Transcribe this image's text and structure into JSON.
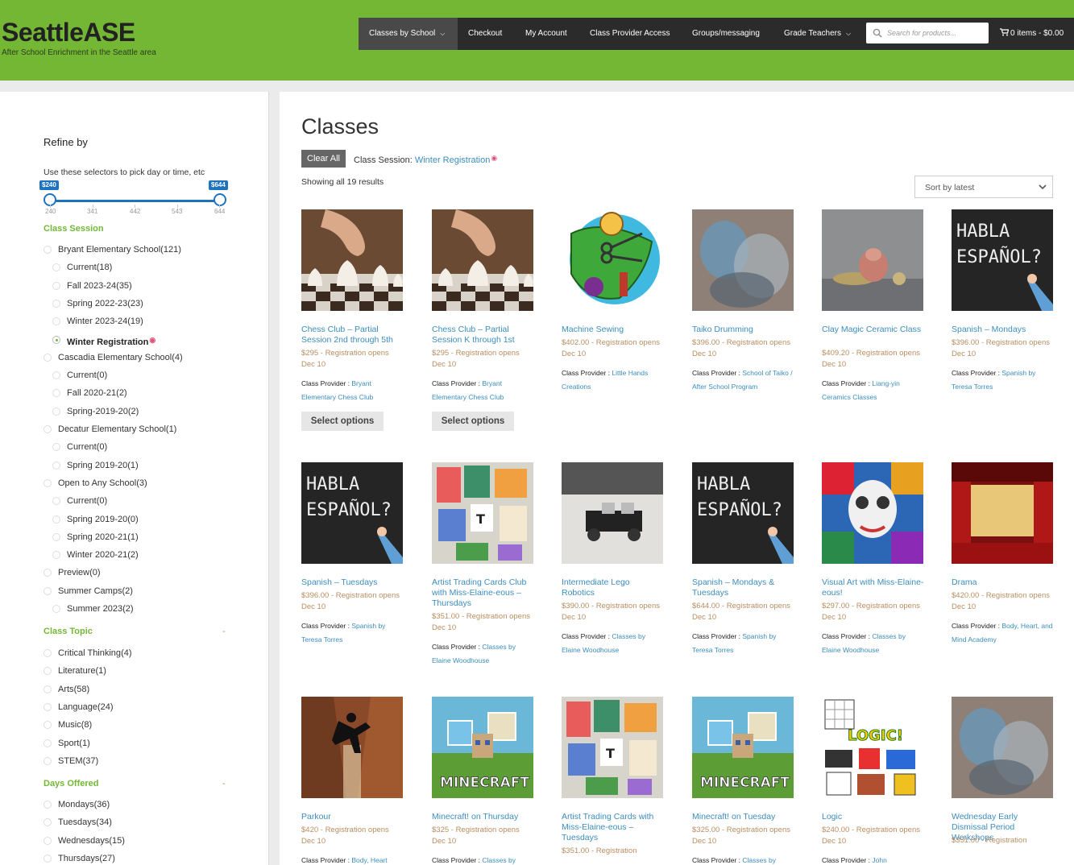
{
  "site": {
    "title": "SeattleASE",
    "tagline": "After School Enrichment in the Seattle area"
  },
  "nav": {
    "items": [
      {
        "label": "Classes by School",
        "has_caret": true
      },
      {
        "label": "Checkout"
      },
      {
        "label": "My Account"
      },
      {
        "label": "Class Provider Access"
      },
      {
        "label": "Groups/messaging"
      },
      {
        "label": "Grade Teachers",
        "has_caret": true
      }
    ],
    "search_placeholder": "Search for products...",
    "cart": "0 items - $0.00"
  },
  "sidebar": {
    "refine_title": "Refine by",
    "selectors_hint": "Use these selectors to pick day or time, etc",
    "price": {
      "min_label": "$240",
      "max_label": "$644",
      "ticks": [
        "240",
        "341",
        "442",
        "543",
        "644"
      ]
    },
    "class_session": {
      "title": "Class Session",
      "items": [
        {
          "label": "Bryant Elementary School",
          "count": "(121)",
          "level": 0
        },
        {
          "label": "Current",
          "count": "(18)",
          "level": 1
        },
        {
          "label": "Fall 2023-24",
          "count": "(35)",
          "level": 1
        },
        {
          "label": "Spring 2022-23",
          "count": "(23)",
          "level": 1
        },
        {
          "label": "Winter 2023-24",
          "count": "(19)",
          "level": 1
        },
        {
          "label": "Winter Registration",
          "count": "",
          "level": 1,
          "selected": true
        },
        {
          "label": "Cascadia Elementary School",
          "count": "(4)",
          "level": 0
        },
        {
          "label": "Current",
          "count": "(0)",
          "level": 1
        },
        {
          "label": "Fall 2020-21",
          "count": "(2)",
          "level": 1
        },
        {
          "label": "Spring-2019-20",
          "count": "(2)",
          "level": 1
        },
        {
          "label": "Decatur Elementary School",
          "count": "(1)",
          "level": 0
        },
        {
          "label": "Current",
          "count": "(0)",
          "level": 1
        },
        {
          "label": "Spring 2019-20",
          "count": "(1)",
          "level": 1
        },
        {
          "label": "Open to Any School",
          "count": "(3)",
          "level": 0
        },
        {
          "label": "Current",
          "count": "(0)",
          "level": 1
        },
        {
          "label": "Spring 2019-20",
          "count": "(0)",
          "level": 1
        },
        {
          "label": "Spring 2020-21",
          "count": "(1)",
          "level": 1
        },
        {
          "label": "Winter 2020-21",
          "count": "(2)",
          "level": 1
        },
        {
          "label": "Preview",
          "count": "(0)",
          "level": 0
        },
        {
          "label": "Summer Camps",
          "count": "(2)",
          "level": 0
        },
        {
          "label": "Summer 2023",
          "count": "(2)",
          "level": 1
        }
      ]
    },
    "class_topic": {
      "title": "Class Topic",
      "toggle": "-",
      "items": [
        {
          "label": "Critical Thinking",
          "count": "(4)"
        },
        {
          "label": "Literature",
          "count": "(1)"
        },
        {
          "label": "Arts",
          "count": "(58)"
        },
        {
          "label": "Language",
          "count": "(24)"
        },
        {
          "label": "Music",
          "count": "(8)"
        },
        {
          "label": "Sport",
          "count": "(1)"
        },
        {
          "label": "STEM",
          "count": "(37)"
        }
      ]
    },
    "days_offered": {
      "title": "Days Offered",
      "toggle": "-",
      "items": [
        {
          "label": "Mondays",
          "count": "(36)"
        },
        {
          "label": "Tuesdays",
          "count": "(34)"
        },
        {
          "label": "Wednesdays",
          "count": "(15)"
        },
        {
          "label": "Thursdays",
          "count": "(27)"
        }
      ]
    }
  },
  "main": {
    "title": "Classes",
    "clear_all": "Clear All",
    "active_filter": {
      "label": "Class Session:",
      "value": "Winter Registration"
    },
    "results": "Showing all 19 results",
    "sort": "Sort by latest",
    "provider_prefix": "Class Provider :",
    "products": [
      {
        "name": "Chess Club – Partial Session 2nd through 5th",
        "price": "$295 - Registration opens Dec 10",
        "provider": "Bryant Elementary Chess Club",
        "button": "Select options",
        "image": "chess"
      },
      {
        "name": "Chess Club – Partial Session K through 1st",
        "price": "$295 - Registration opens Dec 10",
        "provider": "Bryant Elementary Chess Club",
        "button": "Select options",
        "image": "chess"
      },
      {
        "name": "Machine Sewing",
        "price": "$402.00 - Registration opens Dec 10",
        "provider": "Little Hands Creations",
        "image": "sewing"
      },
      {
        "name": "Taiko Drumming",
        "price": "$396.00 - Registration opens Dec 10",
        "provider": "School of Taiko / After School Program",
        "image": "blurred-photo"
      },
      {
        "name": "Clay Magic Ceramic Class",
        "price": "$409.20 - Registration opens Dec 10",
        "provider": "Liang-yin Ceramics Classes",
        "image": "ceramics"
      },
      {
        "name": "Spanish – Mondays",
        "price": "$396.00 - Registration opens Dec 10",
        "provider": "Spanish by Teresa Torres",
        "image": "chalkboard"
      },
      {
        "name": "Spanish – Tuesdays",
        "price": "$396.00 - Registration opens Dec 10",
        "provider": "Spanish by Teresa Torres",
        "image": "chalkboard"
      },
      {
        "name": "Artist Trading Cards Club with Miss-Elaine-eous – Thursdays",
        "price": "$351.00 - Registration opens Dec 10",
        "provider": "Classes by Elaine Woodhouse",
        "image": "cards"
      },
      {
        "name": "Intermediate Lego Robotics",
        "price": "$390.00 - Registration opens Dec 10",
        "provider": "Classes by Elaine Woodhouse",
        "image": "lego"
      },
      {
        "name": "Spanish – Mondays & Tuesdays",
        "price": "$644.00 - Registration opens Dec 10",
        "provider": "Spanish by Teresa Torres",
        "image": "chalkboard"
      },
      {
        "name": "Visual Art with Miss-Elaine-eous!",
        "price": "$297.00 - Registration opens Dec 10",
        "provider": "Classes by Elaine Woodhouse",
        "image": "mosaic"
      },
      {
        "name": "Drama",
        "price": "$420.00 - Registration opens Dec 10",
        "provider": "Body, Heart, and Mind Academy",
        "image": "stage"
      },
      {
        "name": "Parkour",
        "price": "$420 - Registration opens Dec 10",
        "provider": "Body, Heart",
        "image": "parkour"
      },
      {
        "name": "Minecraft! on Thursday",
        "price": "$325 - Registration opens Dec 10",
        "provider": "Classes by",
        "image": "minecraft"
      },
      {
        "name": "Artist Trading Cards with Miss-Elaine-eous – Tuesdays",
        "price": "$351.00 - Registration",
        "provider": "",
        "image": "cards"
      },
      {
        "name": "Minecraft! on Tuesday",
        "price": "$325.00 - Registration opens Dec 10",
        "provider": "Classes by",
        "image": "minecraft"
      },
      {
        "name": "Logic",
        "price": "$240.00 - Registration opens Dec 10",
        "provider": "John",
        "image": "logic"
      },
      {
        "name": "Wednesday Early Dismissal Period Workshops",
        "price": "$351.00 - Registration",
        "provider": "",
        "image": "blurred-photo"
      }
    ]
  },
  "icons": [
    "search-icon",
    "cart-icon",
    "chevron-down-icon"
  ],
  "colors": {
    "header_green": "#73b734",
    "nav_bg": "#2b2b2b",
    "link_blue": "#3c8dbc",
    "price_tan": "#b88e61",
    "slider_blue": "#1e73be",
    "filter_dot": "#e2507a"
  }
}
